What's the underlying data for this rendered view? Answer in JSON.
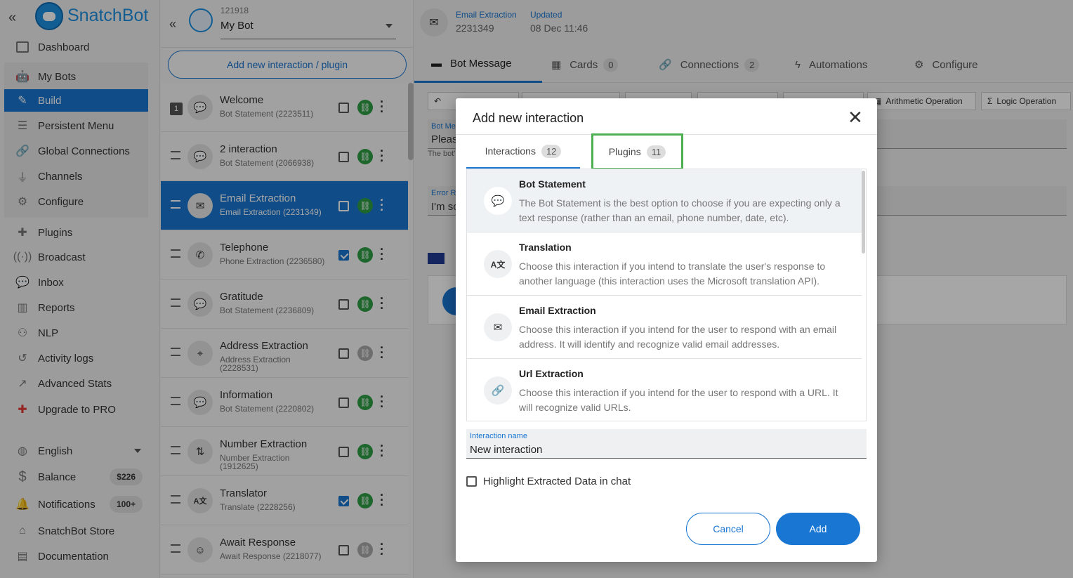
{
  "app": {
    "name": "SnatchBot"
  },
  "sidebar": {
    "items": [
      {
        "label": "Dashboard",
        "icon": "dashboard-icon"
      },
      {
        "label": "My Bots",
        "icon": "robot-icon"
      },
      {
        "label": "Build",
        "icon": "pencil-icon"
      },
      {
        "label": "Persistent Menu",
        "icon": "menu-icon"
      },
      {
        "label": "Global Connections",
        "icon": "link-icon"
      },
      {
        "label": "Channels",
        "icon": "plug-icon"
      },
      {
        "label": "Configure",
        "icon": "gear-icon"
      },
      {
        "label": "Plugins",
        "icon": "puzzle-icon"
      },
      {
        "label": "Broadcast",
        "icon": "broadcast-icon"
      },
      {
        "label": "Inbox",
        "icon": "chat-icon"
      },
      {
        "label": "Reports",
        "icon": "bar-chart-icon"
      },
      {
        "label": "NLP",
        "icon": "nlp-icon"
      },
      {
        "label": "Activity logs",
        "icon": "history-icon"
      },
      {
        "label": "Advanced Stats",
        "icon": "line-chart-icon"
      },
      {
        "label": "Upgrade to PRO",
        "icon": "plus-circle-icon"
      },
      {
        "label": "English",
        "icon": "globe-icon"
      },
      {
        "label": "Balance",
        "icon": "dollar-icon",
        "badge": "$226"
      },
      {
        "label": "Notifications",
        "icon": "bell-icon",
        "badge": "100+"
      },
      {
        "label": "SnatchBot Store",
        "icon": "store-icon"
      },
      {
        "label": "Documentation",
        "icon": "document-icon"
      }
    ]
  },
  "bot": {
    "id": "121918",
    "name": "My Bot"
  },
  "interactions_panel": {
    "add_label": "Add new interaction / plugin",
    "rows": [
      {
        "title": "Welcome",
        "sub": "Bot Statement (2223511)",
        "num": "1",
        "checked": false,
        "linked": true
      },
      {
        "title": "2 interaction",
        "sub": "Bot Statement (2066938)",
        "checked": false,
        "linked": true
      },
      {
        "title": "Email Extraction",
        "sub": "Email Extraction (2231349)",
        "checked": false,
        "linked": true,
        "selected": true
      },
      {
        "title": "Telephone",
        "sub": "Phone Extraction (2236580)",
        "checked": true,
        "linked": true
      },
      {
        "title": "Gratitude",
        "sub": "Bot Statement (2236809)",
        "checked": false,
        "linked": true
      },
      {
        "title": "Address Extraction",
        "sub": "Address Extraction (2228531)",
        "checked": false,
        "linked": false
      },
      {
        "title": "Information",
        "sub": "Bot Statement (2220802)",
        "checked": false,
        "linked": true
      },
      {
        "title": "Number Extraction",
        "sub": "Number Extraction (1912625)",
        "checked": false,
        "linked": true
      },
      {
        "title": "Translator",
        "sub": "Translate (2228256)",
        "checked": true,
        "linked": true
      },
      {
        "title": "Await Response",
        "sub": "Await Response (2218077)",
        "checked": false,
        "linked": false
      }
    ]
  },
  "main": {
    "header": {
      "type_label": "Email Extraction",
      "id": "2231349",
      "updated_label": "Updated",
      "updated_value": "08 Dec 11:46"
    },
    "tabs": [
      {
        "label": "Bot Message"
      },
      {
        "label": "Cards",
        "count": "0"
      },
      {
        "label": "Connections",
        "count": "2"
      },
      {
        "label": "Automations"
      },
      {
        "label": "Configure"
      }
    ],
    "tools": {
      "arith": "Arithmetic Operation",
      "logic": "Logic Operation"
    },
    "bg": {
      "bot_msg_label": "Bot Me",
      "bot_msg_value": "Pleas",
      "bot_hint": "The bot'",
      "err_label": "Error R",
      "err_value": "I'm sc"
    }
  },
  "modal": {
    "title": "Add new interaction",
    "tabs": [
      {
        "label": "Interactions",
        "count": "12"
      },
      {
        "label": "Plugins",
        "count": "11"
      }
    ],
    "items": [
      {
        "title": "Bot Statement",
        "desc": "The Bot Statement is the best option to choose if you are expecting only a text response (rather than an email, phone number, date, etc).",
        "icon": "chat-bubble-icon"
      },
      {
        "title": "Translation",
        "desc": "Choose this interaction if you intend to translate the user's response to another language (this interaction uses the Microsoft translation API).",
        "icon": "translate-icon"
      },
      {
        "title": "Email Extraction",
        "desc": "Choose this interaction if you intend for the user to respond with an email address. It will identify and recognize valid email addresses.",
        "icon": "envelope-icon"
      },
      {
        "title": "Url Extraction",
        "desc": "Choose this interaction if you intend for the user to respond with a URL. It will recognize valid URLs.",
        "icon": "link-icon"
      }
    ],
    "name_field": {
      "label": "Interaction name",
      "value": "New interaction"
    },
    "highlight_label": "Highlight Extracted Data in chat",
    "cancel_label": "Cancel",
    "add_label": "Add"
  }
}
